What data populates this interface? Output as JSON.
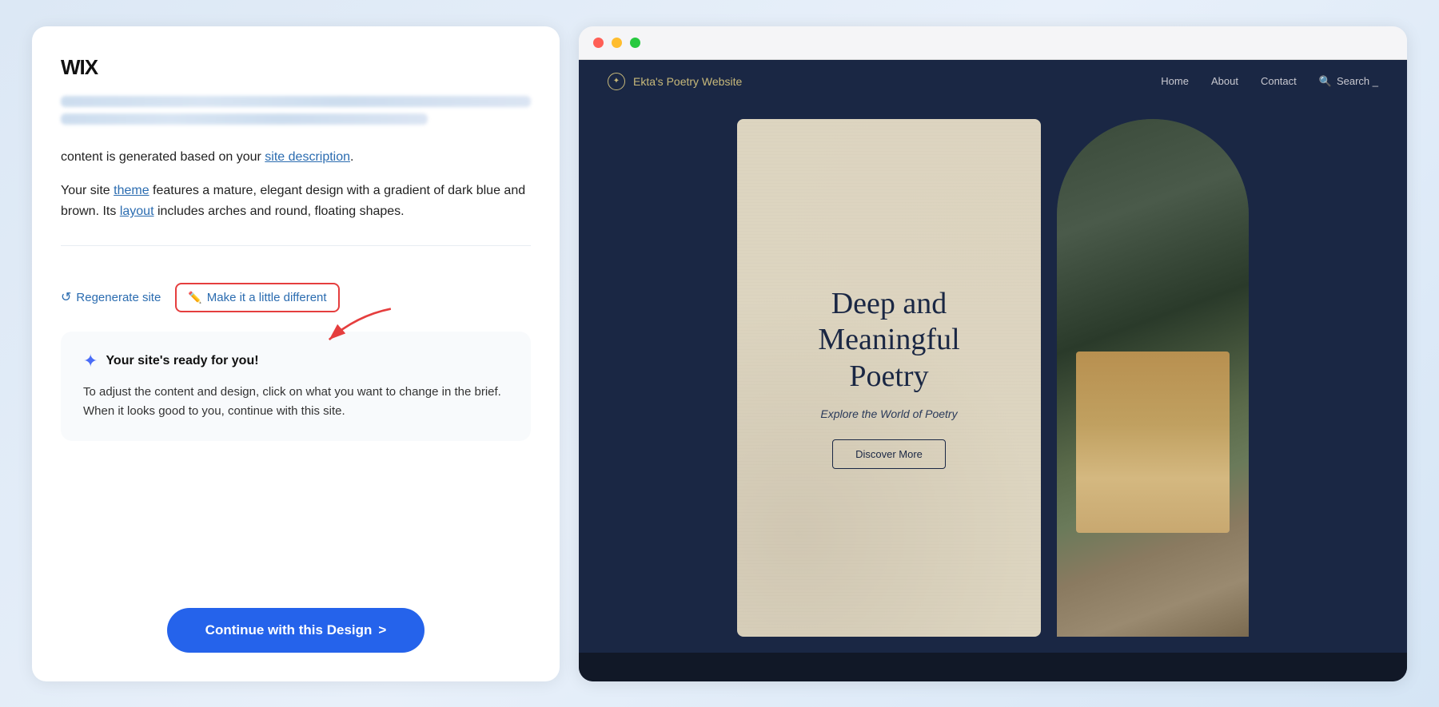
{
  "app": {
    "background": "#d5e5f5"
  },
  "left_panel": {
    "logo": "WIX",
    "blurred_lines": [
      "full",
      "medium"
    ],
    "description_1": "content is generated based on your ",
    "link_site_description": "site description",
    "description_2": ".",
    "description_3": "Your site ",
    "link_theme": "theme",
    "description_4": " features a mature, elegant design with a gradient of dark blue and brown. Its ",
    "link_layout": "layout",
    "description_5": " includes arches and round, floating shapes.",
    "btn_regenerate": "Regenerate site",
    "btn_make_different": "Make it a little different",
    "ready_title": "Your site's ready for you!",
    "ready_body": "To adjust the content and design, click on what you want to change in the brief. When it looks good to you, continue with this site.",
    "continue_btn": "Continue with this Design",
    "continue_arrow": ">"
  },
  "right_panel": {
    "browser": {
      "dots": [
        "red",
        "yellow",
        "green"
      ]
    },
    "website": {
      "nav": {
        "brand_icon": "✦",
        "brand_name": "Ekta's Poetry Website",
        "links": [
          "Home",
          "About",
          "Contact"
        ],
        "search_placeholder": "Search _"
      },
      "hero": {
        "title_line1": "Deep and",
        "title_line2": "Meaningful",
        "title_line3": "Poetry",
        "subtitle": "Explore the World of Poetry",
        "cta_button": "Discover More"
      }
    }
  }
}
